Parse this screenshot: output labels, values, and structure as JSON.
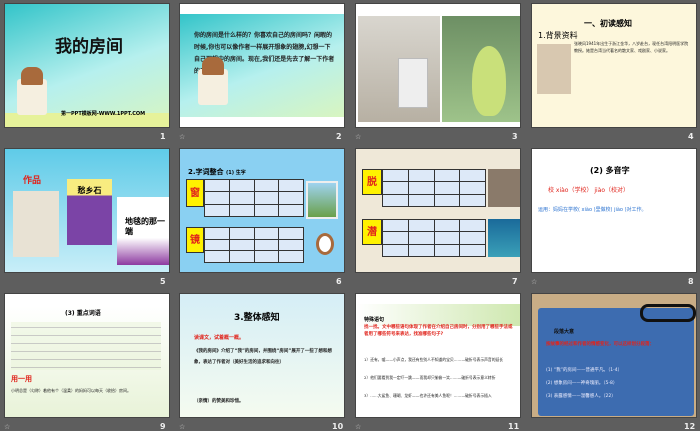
{
  "slides": [
    {
      "num": "1",
      "title": "我的房间",
      "footer": "第一PPT模板网-WWW.1PPT.COM"
    },
    {
      "num": "2",
      "body": "你的房间是什么样的？你喜欢自己的房间吗？闲暇的时候,你也可以像作者一样展开想象的翅膀,幻想一下自己理想中的房间。现在,我们还是先去了解一下作者的房间吧！"
    },
    {
      "num": "3"
    },
    {
      "num": "4",
      "heading": "一、初读感知",
      "sub": "1.背景资料",
      "body": "张晓风1941年出生于浙江金华，八岁赴台，现任台湾阳明医学院教授。她是台湾当代著名的散文家、戏剧家、小说家。"
    },
    {
      "num": "5",
      "label": "作品",
      "book1": "愁乡石",
      "book2": "地毯的那一端"
    },
    {
      "num": "6",
      "heading": "2.字词整合",
      "sub": "(1) 生字",
      "char1": "窗",
      "char2": "镜"
    },
    {
      "num": "7",
      "char1": "脱",
      "char2": "潜"
    },
    {
      "num": "8",
      "heading": "(2) 多音字",
      "line1": "校 xiào（学校）  jiào（校对）",
      "line2": "运用：妈妈在学校( xiào )里做校( jiào )对工作。"
    },
    {
      "num": "9",
      "heading": "(3) 重点词语",
      "sub": "用一用",
      "body": "小明总是（匀称）着他有个（温柔）的妈妈可以每天（收拾）房间。"
    },
    {
      "num": "10",
      "heading": "3.整体感知",
      "l1": "读课文，试着概一概。",
      "l2": "《我的房间》介绍了“我”的房间，并围绕“房间”展开了一些了想和想象，表达了作者对（美好生活的追求和向往）",
      "l3": "（亲情）的赞美和珍惜。"
    },
    {
      "num": "11",
      "heading": "特殊语句",
      "q": "找一找。文中哪些语句体现了作者在介绍自己房间时，分别用了哪些手法或者用了哪些符号来表达，找准哪些句子?",
      "a1": "1）还有，嘘——小声点，我还有些别人不知道的宝贝……—破折号表示声音的延长",
      "a2": "2）他们要看到我一定吓一跳——而我却只偷偷一笑……—破折号表示意义转折",
      "a3": "3）……大鲨鱼、珊瑚、龙虾——也许还有美人鱼呢！……—破折号表示插入"
    },
    {
      "num": "12",
      "heading": "段落大意",
      "q": "按故事的经过和作者的情感变化，可以这样划分段落：",
      "a1": "(1) “我”的房间——普通平凡。（1-4）",
      "a2": "(2) 想象房间——神奇瑰丽。（5-8）",
      "a3": "(3) 表露感情——温馨感人。（22）"
    }
  ],
  "star_icon": "☆"
}
